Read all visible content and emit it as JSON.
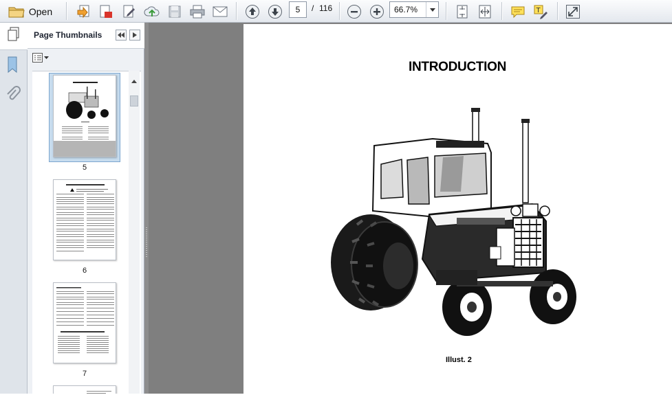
{
  "toolbar": {
    "open_label": "Open",
    "page_current": "5",
    "page_separator": "/",
    "page_total": "116",
    "zoom_value": "66.7%"
  },
  "panel": {
    "title": "Page Thumbnails"
  },
  "thumbnails": [
    {
      "page": "5",
      "selected": true
    },
    {
      "page": "6",
      "selected": false
    },
    {
      "page": "7",
      "selected": false
    }
  ],
  "document": {
    "heading": "INTRODUCTION",
    "caption": "Illust. 2"
  },
  "colors": {
    "toolbar_bg": "#e4e8ee",
    "doc_bg": "#7f7f7f",
    "selection": "#c7dcee"
  }
}
